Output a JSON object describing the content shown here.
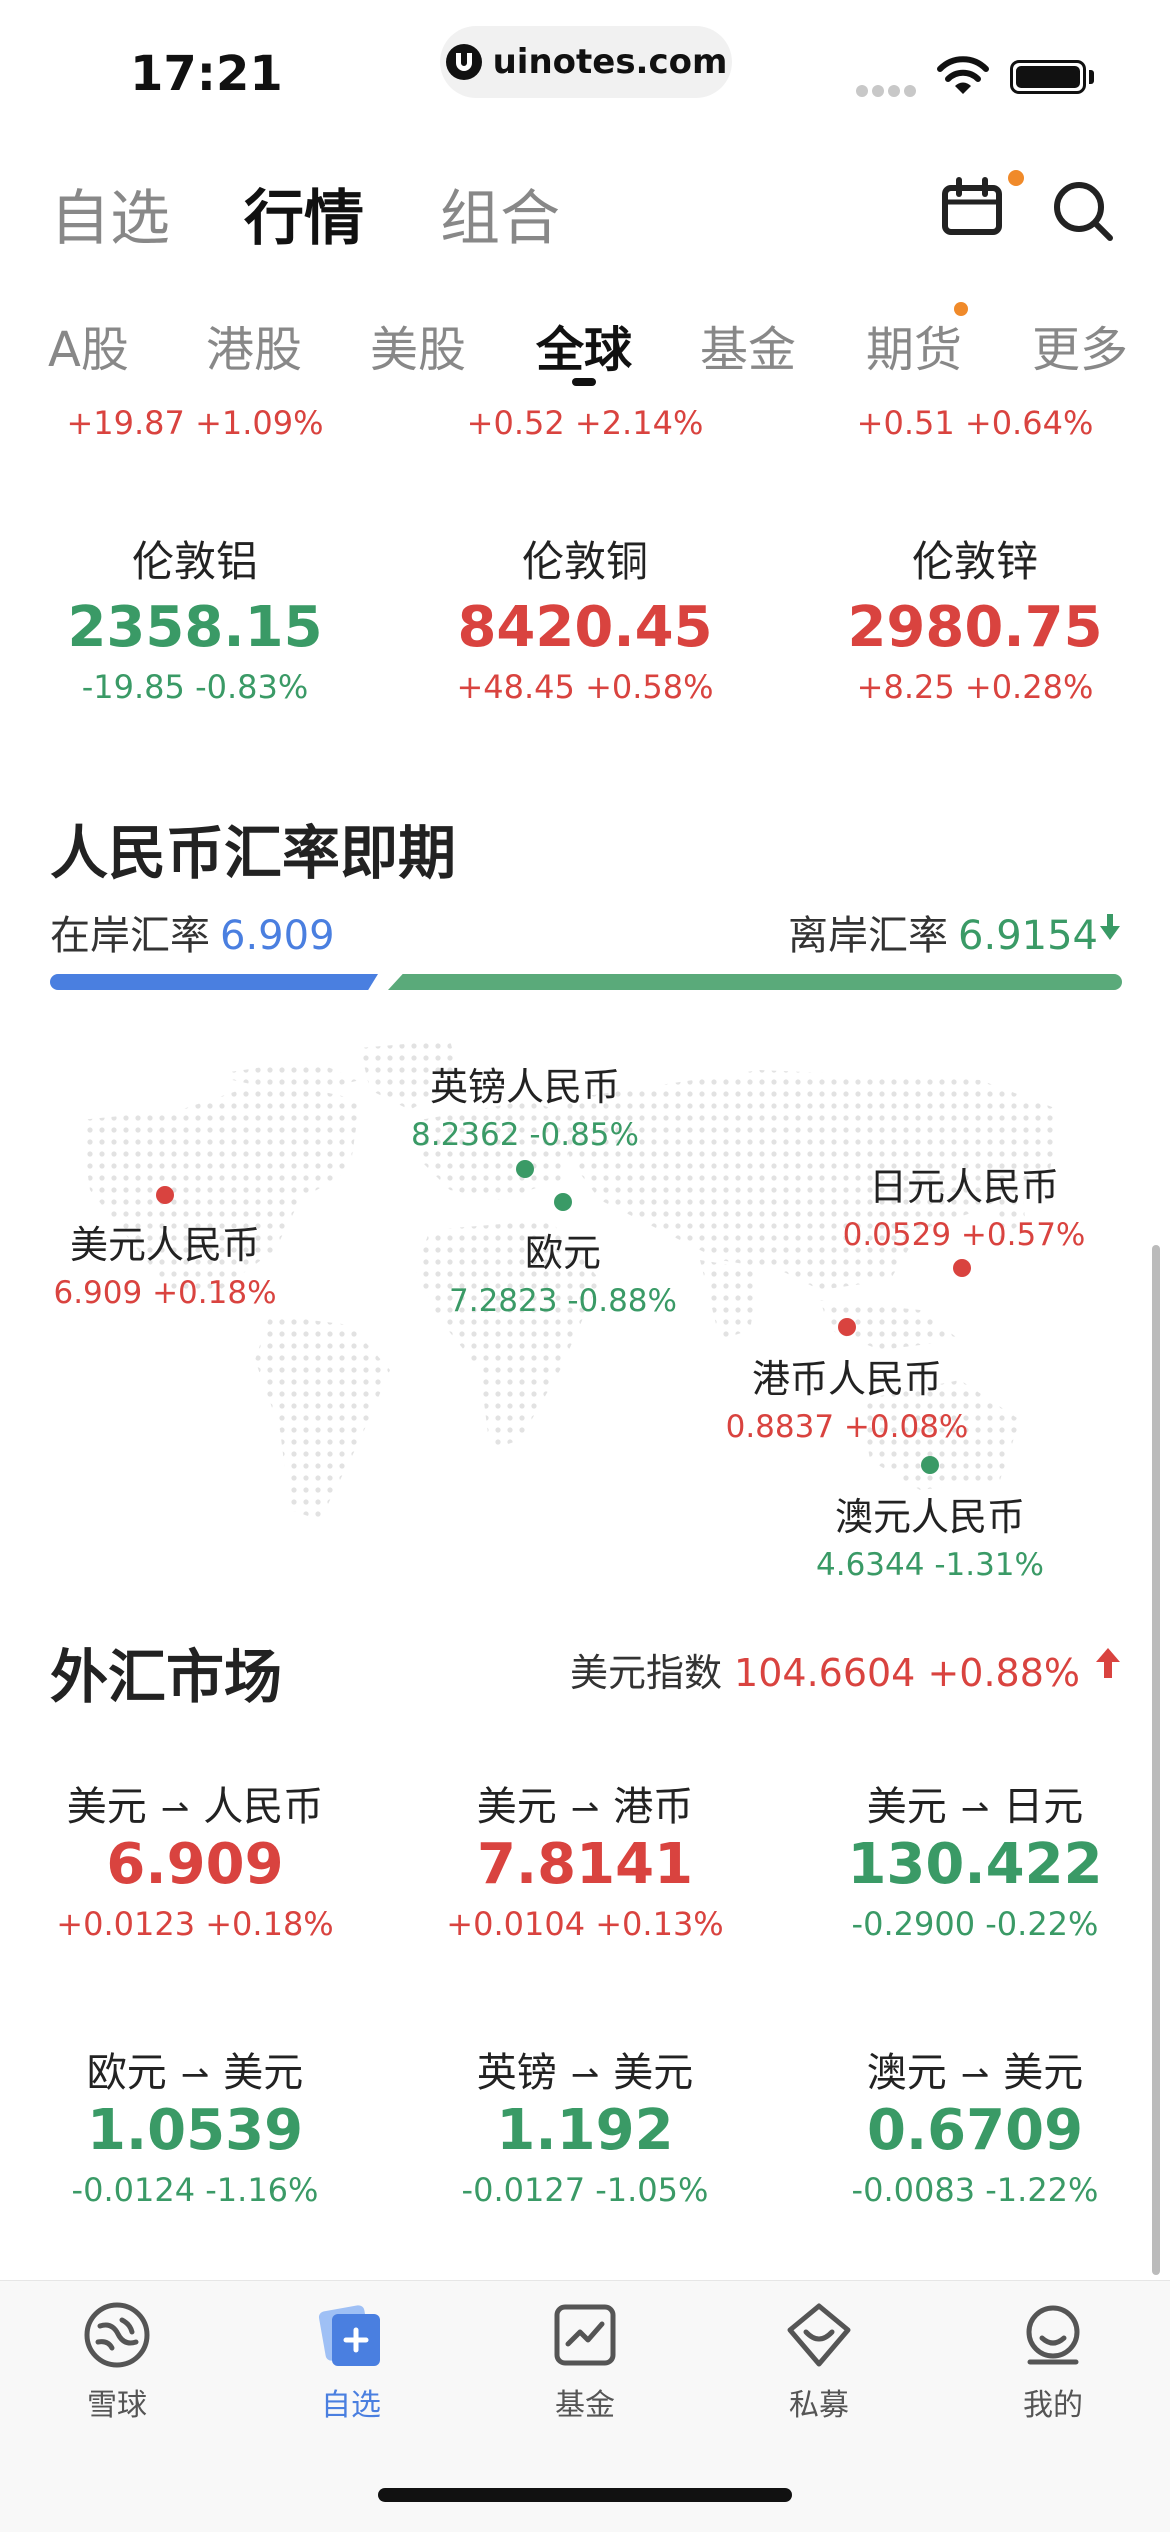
{
  "status_bar": {
    "time": "17:21",
    "url": "uinotes.com"
  },
  "header": {
    "tabs": [
      "自选",
      "行情",
      "组合"
    ],
    "active_tab": "行情"
  },
  "sub_tabs": [
    "A股",
    "港股",
    "美股",
    "全球",
    "基金",
    "期货",
    "更多"
  ],
  "partial_row": [
    "+19.87 +1.09%",
    "+0.52 +2.14%",
    "+0.51 +0.64%"
  ],
  "metals": [
    {
      "name": "伦敦铝",
      "value": "2358.15",
      "change": "-19.85 -0.83%",
      "dir": "down"
    },
    {
      "name": "伦敦铜",
      "value": "8420.45",
      "change": "+48.45 +0.58%",
      "dir": "up"
    },
    {
      "name": "伦敦锌",
      "value": "2980.75",
      "change": "+8.25 +0.28%",
      "dir": "up"
    }
  ],
  "rmb": {
    "title": "人民币汇率即期",
    "onshore_label": "在岸汇率",
    "onshore_value": "6.909",
    "offshore_label": "离岸汇率",
    "offshore_value": "6.9154"
  },
  "map_rates": {
    "gbp": {
      "name": "英镑人民币",
      "value": "8.2362 -0.85%"
    },
    "usd": {
      "name": "美元人民币",
      "value": "6.909 +0.18%"
    },
    "eur": {
      "name": "欧元",
      "value": "7.2823 -0.88%"
    },
    "jpy": {
      "name": "日元人民币",
      "value": "0.0529 +0.57%"
    },
    "hkd": {
      "name": "港币人民币",
      "value": "0.8837 +0.08%"
    },
    "aud": {
      "name": "澳元人民币",
      "value": "4.6344 -1.31%"
    }
  },
  "forex": {
    "title": "外汇市场",
    "index_label": "美元指数",
    "index_value": "104.6604 +0.88%",
    "pairs": [
      {
        "from": "美元",
        "to": "人民币",
        "value": "6.909",
        "change": "+0.0123 +0.18%",
        "dir": "up"
      },
      {
        "from": "美元",
        "to": "港币",
        "value": "7.8141",
        "change": "+0.0104 +0.13%",
        "dir": "up"
      },
      {
        "from": "美元",
        "to": "日元",
        "value": "130.422",
        "change": "-0.2900 -0.22%",
        "dir": "down"
      },
      {
        "from": "欧元",
        "to": "美元",
        "value": "1.0539",
        "change": "-0.0124 -1.16%",
        "dir": "down"
      },
      {
        "from": "英镑",
        "to": "美元",
        "value": "1.192",
        "change": "-0.0127 -1.05%",
        "dir": "down"
      },
      {
        "from": "澳元",
        "to": "美元",
        "value": "0.6709",
        "change": "-0.0083 -1.22%",
        "dir": "down"
      }
    ]
  },
  "tab_bar": [
    {
      "label": "雪球",
      "icon": "snowball-icon"
    },
    {
      "label": "自选",
      "icon": "watchlist-icon",
      "active": true
    },
    {
      "label": "基金",
      "icon": "fund-chart-icon"
    },
    {
      "label": "私募",
      "icon": "private-fund-icon"
    },
    {
      "label": "我的",
      "icon": "profile-icon"
    }
  ],
  "colors": {
    "up": "#d9433f",
    "down": "#3a9a66",
    "accent": "#4a7fe0",
    "highlight_dot": "#f08a2a"
  }
}
